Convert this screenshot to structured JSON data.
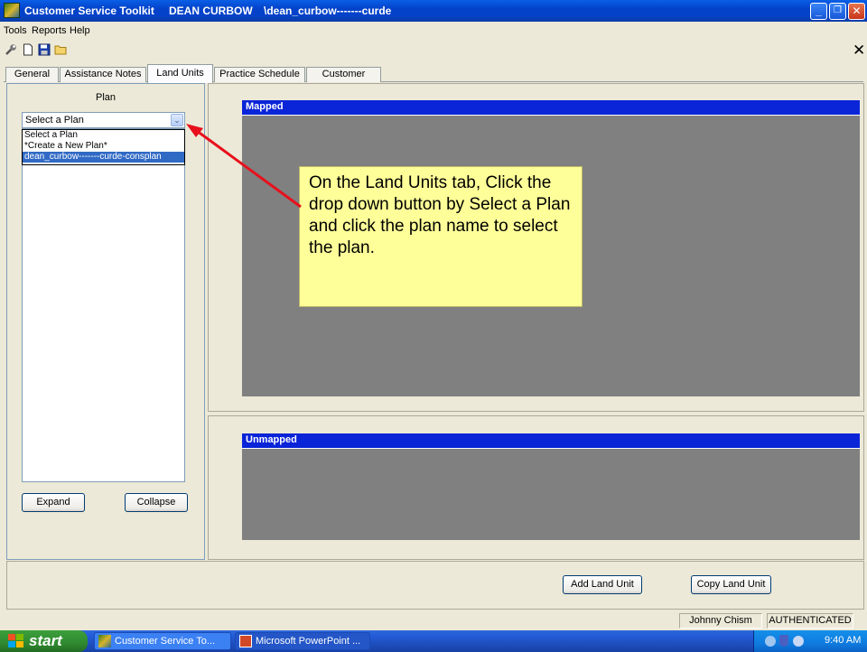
{
  "window": {
    "app_name": "Customer Service Toolkit",
    "customer_name": "DEAN CURBOW",
    "path": "\\dean_curbow-------curde",
    "minimize_glyph": "_",
    "maximize_glyph": "❐",
    "close_glyph": "✕"
  },
  "menu": [
    "Tools",
    "Reports",
    "Help"
  ],
  "toolbar": {
    "icons": [
      "wrench-icon",
      "new-document-icon",
      "save-icon",
      "open-folder-icon"
    ],
    "close_glyph": "✕"
  },
  "tabs": [
    {
      "label": "General",
      "active": false
    },
    {
      "label": "Assistance Notes",
      "active": false
    },
    {
      "label": "Land Units",
      "active": true
    },
    {
      "label": "Practice Schedule",
      "active": false
    },
    {
      "label": "Customer Files",
      "active": false
    }
  ],
  "plan_panel": {
    "heading": "Plan",
    "selected": "Select a Plan",
    "options": [
      "Select a Plan",
      "*Create a New Plan*",
      "dean_curbow-------curde-consplan"
    ],
    "highlighted_option": 2,
    "expand_label": "Expand",
    "collapse_label": "Collapse"
  },
  "mapped": {
    "header": "Mapped"
  },
  "unmapped": {
    "header": "Unmapped"
  },
  "actions": {
    "add_label": "Add Land Unit",
    "copy_label": "Copy Land Unit"
  },
  "callout": {
    "text": "On the Land Units tab, Click the drop down button by Select a Plan and click the plan name to select the plan."
  },
  "status": {
    "user": "Johnny Chism",
    "auth": "AUTHENTICATED"
  },
  "taskbar": {
    "start_label": "start",
    "items": [
      "Customer Service To...",
      "Microsoft PowerPoint ..."
    ],
    "clock": "9:40 AM"
  },
  "colors": {
    "titlebar": "#0342c9",
    "grid_header": "#0a24d8",
    "grid_body": "#808080",
    "callout_bg": "#ffff99",
    "arrow": "#e8101c",
    "selection": "#316ac5"
  }
}
